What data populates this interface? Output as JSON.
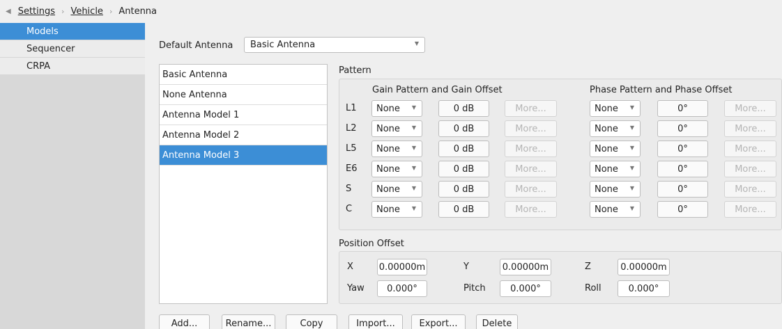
{
  "breadcrumb": {
    "back_icon": "back-arrow-icon",
    "items": [
      "Settings",
      "Vehicle",
      "Antenna"
    ]
  },
  "sidebar": {
    "items": [
      {
        "label": "Models",
        "active": true
      },
      {
        "label": "Sequencer",
        "active": false
      },
      {
        "label": "CRPA",
        "active": false
      }
    ]
  },
  "default_antenna": {
    "label": "Default Antenna",
    "value": "Basic Antenna"
  },
  "models": {
    "items": [
      "Basic Antenna",
      "None Antenna",
      "Antenna Model 1",
      "Antenna Model 2",
      "Antenna Model 3"
    ],
    "selected": "Antenna Model 3"
  },
  "pattern": {
    "title": "Pattern",
    "gain_title": "Gain Pattern and Gain Offset",
    "phase_title": "Phase Pattern and Phase Offset",
    "rows": [
      {
        "band": "L1",
        "gain_pattern": "None",
        "gain_offset": "0 dB",
        "gain_more": "More...",
        "phase_pattern": "None",
        "phase_offset": "0°",
        "phase_more": "More..."
      },
      {
        "band": "L2",
        "gain_pattern": "None",
        "gain_offset": "0 dB",
        "gain_more": "More...",
        "phase_pattern": "None",
        "phase_offset": "0°",
        "phase_more": "More..."
      },
      {
        "band": "L5",
        "gain_pattern": "None",
        "gain_offset": "0 dB",
        "gain_more": "More...",
        "phase_pattern": "None",
        "phase_offset": "0°",
        "phase_more": "More..."
      },
      {
        "band": "E6",
        "gain_pattern": "None",
        "gain_offset": "0 dB",
        "gain_more": "More...",
        "phase_pattern": "None",
        "phase_offset": "0°",
        "phase_more": "More..."
      },
      {
        "band": "S",
        "gain_pattern": "None",
        "gain_offset": "0 dB",
        "gain_more": "More...",
        "phase_pattern": "None",
        "phase_offset": "0°",
        "phase_more": "More..."
      },
      {
        "band": "C",
        "gain_pattern": "None",
        "gain_offset": "0 dB",
        "gain_more": "More...",
        "phase_pattern": "None",
        "phase_offset": "0°",
        "phase_more": "More..."
      }
    ]
  },
  "position_offset": {
    "title": "Position Offset",
    "x_label": "X",
    "x_value": "0.00000m",
    "y_label": "Y",
    "y_value": "0.00000m",
    "z_label": "Z",
    "z_value": "0.00000m",
    "yaw_label": "Yaw",
    "yaw_value": "0.000°",
    "pitch_label": "Pitch",
    "pitch_value": "0.000°",
    "roll_label": "Roll",
    "roll_value": "0.000°"
  },
  "actions": {
    "add": "Add...",
    "rename": "Rename...",
    "copy": "Copy",
    "import": "Import...",
    "export": "Export...",
    "delete": "Delete"
  },
  "colors": {
    "accent": "#3c8ed6",
    "sidebar_bg": "#d8d8d8",
    "panel_bg": "#efefef"
  }
}
